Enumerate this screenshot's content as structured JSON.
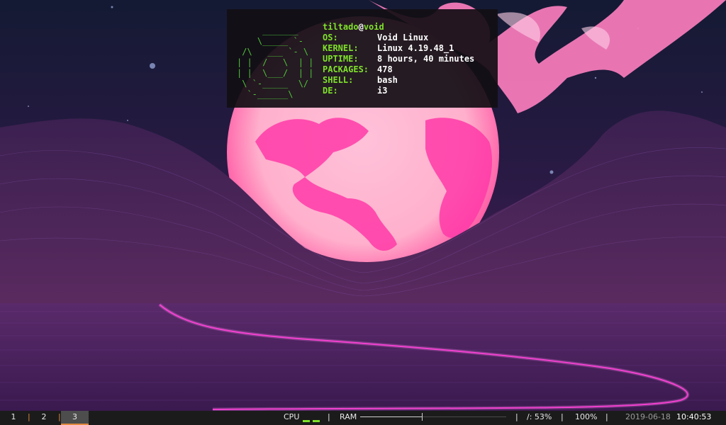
{
  "terminal": {
    "ascii_logo": "     _______\n    \\_____ `-\n /\\   ___ `- \\\n| |  /   \\  | |\n| |  \\___/  | |\n \\ `-_____  \\/\n  `-______\\",
    "user": "tiltado",
    "at": "@",
    "host": "void",
    "rows": [
      {
        "key": "OS:",
        "value": "Void Linux"
      },
      {
        "key": "KERNEL:",
        "value": "Linux 4.19.48_1"
      },
      {
        "key": "UPTIME:",
        "value": "8 hours, 40 minutes"
      },
      {
        "key": "PACKAGES:",
        "value": "478"
      },
      {
        "key": "SHELL:",
        "value": "bash"
      },
      {
        "key": "DE:",
        "value": "i3"
      }
    ]
  },
  "bar": {
    "workspaces": [
      {
        "label": "1",
        "focused": false
      },
      {
        "label": "2",
        "focused": false
      },
      {
        "label": "3",
        "focused": true
      }
    ],
    "workspace_separator": "|",
    "separator": "|",
    "cpu_label": "CPU",
    "ram_label": "RAM",
    "ram_fraction": 0.42,
    "disk": "/: 53%",
    "battery": "100%",
    "date": "2019-06-18",
    "time": "10:40:53",
    "colors": {
      "accent": "#e38a3f",
      "green": "#7fe12a",
      "background": "#1b1b1b"
    }
  }
}
